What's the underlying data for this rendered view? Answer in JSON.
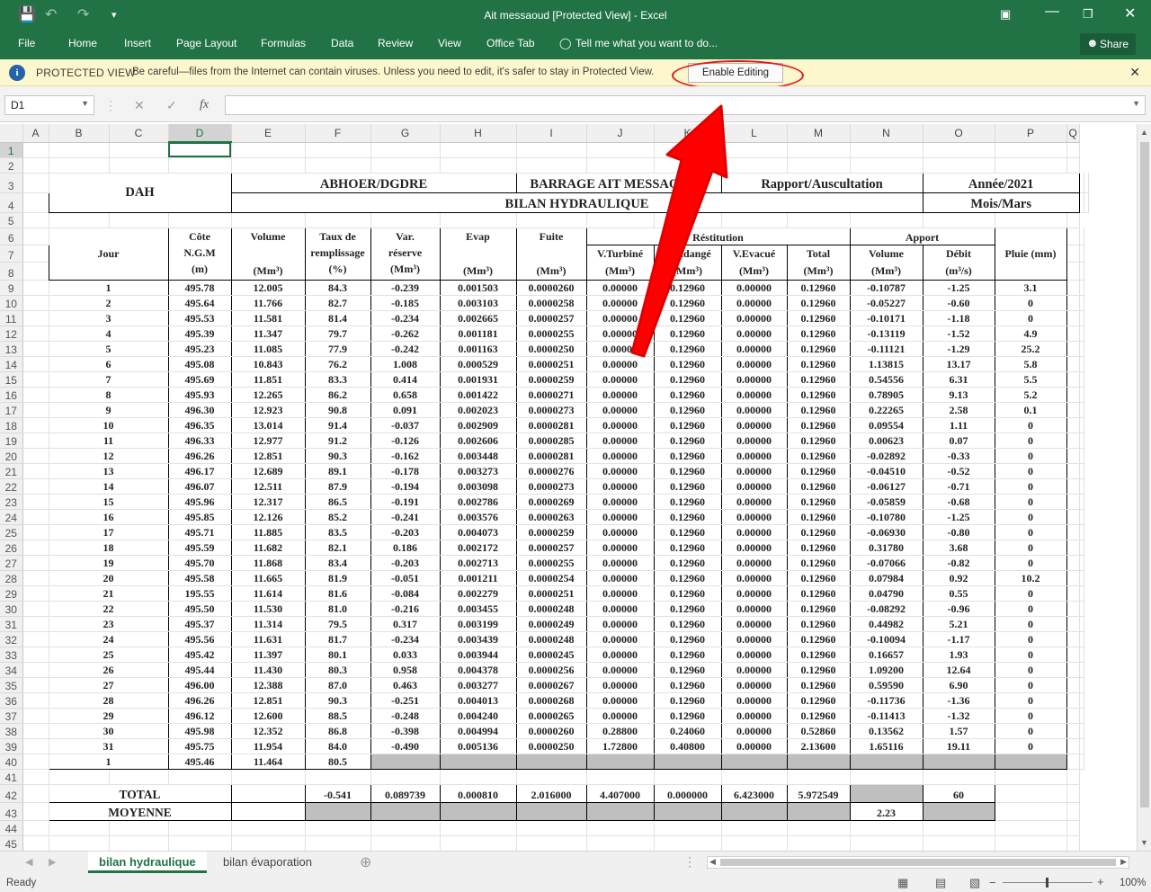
{
  "title": "Ait messaoud  [Protected View] - Excel",
  "ribbon": {
    "tabs": [
      "File",
      "Home",
      "Insert",
      "Page Layout",
      "Formulas",
      "Data",
      "Review",
      "View",
      "Office Tab"
    ],
    "tell_me": "Tell me what you want to do...",
    "share": "Share"
  },
  "protected": {
    "title": "PROTECTED VIEW",
    "message": "Be careful—files from the Internet can contain viruses. Unless you need to edit, it's safer to stay in Protected View.",
    "button": "Enable Editing"
  },
  "formula_bar": {
    "name_box": "D1",
    "fx": "fx",
    "value": ""
  },
  "columns": [
    "A",
    "B",
    "C",
    "D",
    "E",
    "F",
    "G",
    "H",
    "I",
    "J",
    "K",
    "L",
    "M",
    "N",
    "O",
    "P",
    "Q"
  ],
  "selected_cell": "D1",
  "header": {
    "org": "DAH",
    "dept": "ABHOER/DGDRE",
    "barrage": "BARRAGE AIT MESSAOUUD",
    "rapport": "Rapport/Auscultation",
    "annee": "Année/2021",
    "bilan": "BILAN HYDRAULIQUE",
    "mois": "Mois/Mars"
  },
  "col_headers": {
    "jour": "Jour",
    "cote": [
      "Côte",
      "N.G.M",
      "(m)"
    ],
    "volume": [
      "Volume",
      "(Mm³)"
    ],
    "taux": [
      "Taux de",
      "remplissage",
      "(%)"
    ],
    "var": [
      "Var.",
      "réserve",
      "(Mm³)"
    ],
    "evap": [
      "Evap",
      "(Mm³)"
    ],
    "fuite": [
      "Fuite",
      "(Mm³)"
    ],
    "restitution": "Réstitution",
    "vturbine": [
      "V.Turbiné",
      "(Mm³)"
    ],
    "vvidange": [
      "V.Vidangé",
      "(Mm³)"
    ],
    "vevacue": [
      "V.Evacué",
      "(Mm³)"
    ],
    "total": [
      "Total",
      "(Mm³)"
    ],
    "apport": "Apport",
    "avolume": [
      "Volume",
      "(Mm³)"
    ],
    "debit": [
      "Débit",
      "(m³/s)"
    ],
    "pluie": "Pluie (mm)"
  },
  "rows": [
    [
      "1",
      "495.78",
      "12.005",
      "84.3",
      "-0.239",
      "0.001503",
      "0.0000260",
      "0.00000",
      "0.12960",
      "0.00000",
      "0.12960",
      "-0.10787",
      "-1.25",
      "3.1"
    ],
    [
      "2",
      "495.64",
      "11.766",
      "82.7",
      "-0.185",
      "0.003103",
      "0.0000258",
      "0.00000",
      "0.12960",
      "0.00000",
      "0.12960",
      "-0.05227",
      "-0.60",
      "0"
    ],
    [
      "3",
      "495.53",
      "11.581",
      "81.4",
      "-0.234",
      "0.002665",
      "0.0000257",
      "0.00000",
      "0.12960",
      "0.00000",
      "0.12960",
      "-0.10171",
      "-1.18",
      "0"
    ],
    [
      "4",
      "495.39",
      "11.347",
      "79.7",
      "-0.262",
      "0.001181",
      "0.0000255",
      "0.00000",
      "0.12960",
      "0.00000",
      "0.12960",
      "-0.13119",
      "-1.52",
      "4.9"
    ],
    [
      "5",
      "495.23",
      "11.085",
      "77.9",
      "-0.242",
      "0.001163",
      "0.0000250",
      "0.00000",
      "0.12960",
      "0.00000",
      "0.12960",
      "-0.11121",
      "-1.29",
      "25.2"
    ],
    [
      "6",
      "495.08",
      "10.843",
      "76.2",
      "1.008",
      "0.000529",
      "0.0000251",
      "0.00000",
      "0.12960",
      "0.00000",
      "0.12960",
      "1.13815",
      "13.17",
      "5.8"
    ],
    [
      "7",
      "495.69",
      "11.851",
      "83.3",
      "0.414",
      "0.001931",
      "0.0000259",
      "0.00000",
      "0.12960",
      "0.00000",
      "0.12960",
      "0.54556",
      "6.31",
      "5.5"
    ],
    [
      "8",
      "495.93",
      "12.265",
      "86.2",
      "0.658",
      "0.001422",
      "0.0000271",
      "0.00000",
      "0.12960",
      "0.00000",
      "0.12960",
      "0.78905",
      "9.13",
      "5.2"
    ],
    [
      "9",
      "496.30",
      "12.923",
      "90.8",
      "0.091",
      "0.002023",
      "0.0000273",
      "0.00000",
      "0.12960",
      "0.00000",
      "0.12960",
      "0.22265",
      "2.58",
      "0.1"
    ],
    [
      "10",
      "496.35",
      "13.014",
      "91.4",
      "-0.037",
      "0.002909",
      "0.0000281",
      "0.00000",
      "0.12960",
      "0.00000",
      "0.12960",
      "0.09554",
      "1.11",
      "0"
    ],
    [
      "11",
      "496.33",
      "12.977",
      "91.2",
      "-0.126",
      "0.002606",
      "0.0000285",
      "0.00000",
      "0.12960",
      "0.00000",
      "0.12960",
      "0.00623",
      "0.07",
      "0"
    ],
    [
      "12",
      "496.26",
      "12.851",
      "90.3",
      "-0.162",
      "0.003448",
      "0.0000281",
      "0.00000",
      "0.12960",
      "0.00000",
      "0.12960",
      "-0.02892",
      "-0.33",
      "0"
    ],
    [
      "13",
      "496.17",
      "12.689",
      "89.1",
      "-0.178",
      "0.003273",
      "0.0000276",
      "0.00000",
      "0.12960",
      "0.00000",
      "0.12960",
      "-0.04510",
      "-0.52",
      "0"
    ],
    [
      "14",
      "496.07",
      "12.511",
      "87.9",
      "-0.194",
      "0.003098",
      "0.0000273",
      "0.00000",
      "0.12960",
      "0.00000",
      "0.12960",
      "-0.06127",
      "-0.71",
      "0"
    ],
    [
      "15",
      "495.96",
      "12.317",
      "86.5",
      "-0.191",
      "0.002786",
      "0.0000269",
      "0.00000",
      "0.12960",
      "0.00000",
      "0.12960",
      "-0.05859",
      "-0.68",
      "0"
    ],
    [
      "16",
      "495.85",
      "12.126",
      "85.2",
      "-0.241",
      "0.003576",
      "0.0000263",
      "0.00000",
      "0.12960",
      "0.00000",
      "0.12960",
      "-0.10780",
      "-1.25",
      "0"
    ],
    [
      "17",
      "495.71",
      "11.885",
      "83.5",
      "-0.203",
      "0.004073",
      "0.0000259",
      "0.00000",
      "0.12960",
      "0.00000",
      "0.12960",
      "-0.06930",
      "-0.80",
      "0"
    ],
    [
      "18",
      "495.59",
      "11.682",
      "82.1",
      "0.186",
      "0.002172",
      "0.0000257",
      "0.00000",
      "0.12960",
      "0.00000",
      "0.12960",
      "0.31780",
      "3.68",
      "0"
    ],
    [
      "19",
      "495.70",
      "11.868",
      "83.4",
      "-0.203",
      "0.002713",
      "0.0000255",
      "0.00000",
      "0.12960",
      "0.00000",
      "0.12960",
      "-0.07066",
      "-0.82",
      "0"
    ],
    [
      "20",
      "495.58",
      "11.665",
      "81.9",
      "-0.051",
      "0.001211",
      "0.0000254",
      "0.00000",
      "0.12960",
      "0.00000",
      "0.12960",
      "0.07984",
      "0.92",
      "10.2"
    ],
    [
      "21",
      "195.55",
      "11.614",
      "81.6",
      "-0.084",
      "0.002279",
      "0.0000251",
      "0.00000",
      "0.12960",
      "0.00000",
      "0.12960",
      "0.04790",
      "0.55",
      "0"
    ],
    [
      "22",
      "495.50",
      "11.530",
      "81.0",
      "-0.216",
      "0.003455",
      "0.0000248",
      "0.00000",
      "0.12960",
      "0.00000",
      "0.12960",
      "-0.08292",
      "-0.96",
      "0"
    ],
    [
      "23",
      "495.37",
      "11.314",
      "79.5",
      "0.317",
      "0.003199",
      "0.0000249",
      "0.00000",
      "0.12960",
      "0.00000",
      "0.12960",
      "0.44982",
      "5.21",
      "0"
    ],
    [
      "24",
      "495.56",
      "11.631",
      "81.7",
      "-0.234",
      "0.003439",
      "0.0000248",
      "0.00000",
      "0.12960",
      "0.00000",
      "0.12960",
      "-0.10094",
      "-1.17",
      "0"
    ],
    [
      "25",
      "495.42",
      "11.397",
      "80.1",
      "0.033",
      "0.003944",
      "0.0000245",
      "0.00000",
      "0.12960",
      "0.00000",
      "0.12960",
      "0.16657",
      "1.93",
      "0"
    ],
    [
      "26",
      "495.44",
      "11.430",
      "80.3",
      "0.958",
      "0.004378",
      "0.0000256",
      "0.00000",
      "0.12960",
      "0.00000",
      "0.12960",
      "1.09200",
      "12.64",
      "0"
    ],
    [
      "27",
      "496.00",
      "12.388",
      "87.0",
      "0.463",
      "0.003277",
      "0.0000267",
      "0.00000",
      "0.12960",
      "0.00000",
      "0.12960",
      "0.59590",
      "6.90",
      "0"
    ],
    [
      "28",
      "496.26",
      "12.851",
      "90.3",
      "-0.251",
      "0.004013",
      "0.0000268",
      "0.00000",
      "0.12960",
      "0.00000",
      "0.12960",
      "-0.11736",
      "-1.36",
      "0"
    ],
    [
      "29",
      "496.12",
      "12.600",
      "88.5",
      "-0.248",
      "0.004240",
      "0.0000265",
      "0.00000",
      "0.12960",
      "0.00000",
      "0.12960",
      "-0.11413",
      "-1.32",
      "0"
    ],
    [
      "30",
      "495.98",
      "12.352",
      "86.8",
      "-0.398",
      "0.004994",
      "0.0000260",
      "0.28800",
      "0.24060",
      "0.00000",
      "0.52860",
      "0.13562",
      "1.57",
      "0"
    ],
    [
      "31",
      "495.75",
      "11.954",
      "84.0",
      "-0.490",
      "0.005136",
      "0.0000250",
      "1.72800",
      "0.40800",
      "0.00000",
      "2.13600",
      "1.65116",
      "19.11",
      "0"
    ]
  ],
  "row40": [
    "1",
    "495.46",
    "11.464",
    "80.5"
  ],
  "total": {
    "label": "TOTAL",
    "var": "-0.541",
    "evap": "0.089739",
    "fuite": "0.000810",
    "turb": "2.016000",
    "vid": "4.407000",
    "evac": "0.000000",
    "tot": "6.423000",
    "apport": "5.972549",
    "pluie": "60"
  },
  "moyenne": {
    "label": "MOYENNE",
    "debit": "2.23"
  },
  "sheets": [
    "bilan hydraulique",
    "bilan évaporation"
  ],
  "status": {
    "ready": "Ready",
    "zoom": "100%"
  }
}
